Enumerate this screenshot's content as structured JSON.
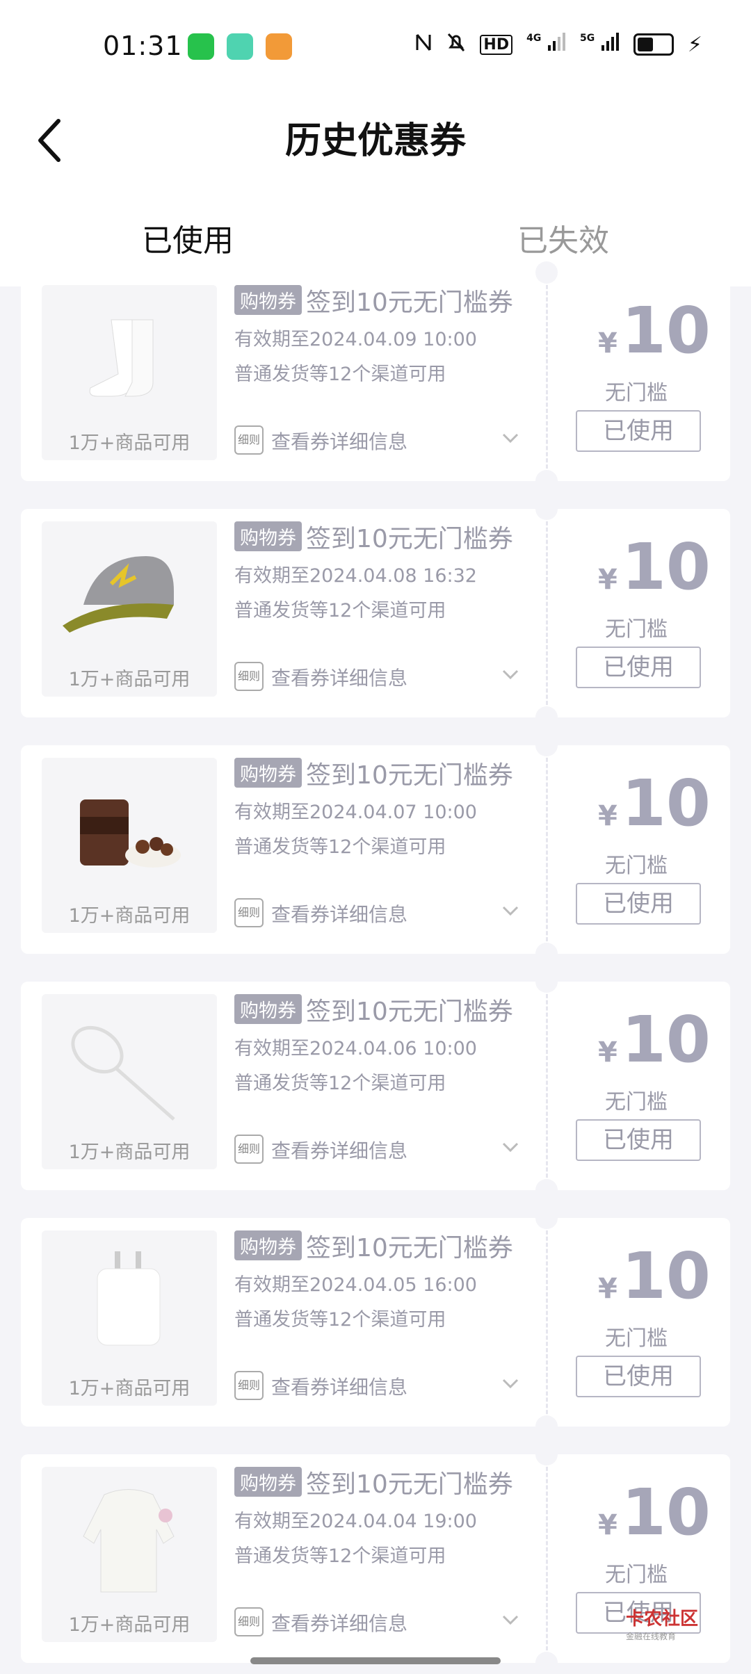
{
  "status_bar": {
    "time": "01:31",
    "hd_label": "HD",
    "net1": "4G",
    "net2": "5G"
  },
  "header": {
    "title": "历史优惠券"
  },
  "tabs": [
    {
      "label": "已使用",
      "active": true
    },
    {
      "label": "已失效",
      "active": false
    }
  ],
  "coupons": [
    {
      "tag": "购物券",
      "title": "签到10元无门槛券",
      "expiry": "有效期至2024.04.09 10:00",
      "channel": "普通发货等12个渠道可用",
      "thumb_caption": "1万+商品可用",
      "details": "查看券详细信息",
      "currency": "¥",
      "amount": "10",
      "threshold": "无门槛",
      "status": "已使用",
      "product_icon": "socks"
    },
    {
      "tag": "购物券",
      "title": "签到10元无门槛券",
      "expiry": "有效期至2024.04.08 16:32",
      "channel": "普通发货等12个渠道可用",
      "thumb_caption": "1万+商品可用",
      "details": "查看券详细信息",
      "currency": "¥",
      "amount": "10",
      "threshold": "无门槛",
      "status": "已使用",
      "product_icon": "cap"
    },
    {
      "tag": "购物券",
      "title": "签到10元无门槛券",
      "expiry": "有效期至2024.04.07 10:00",
      "channel": "普通发货等12个渠道可用",
      "thumb_caption": "1万+商品可用",
      "details": "查看券详细信息",
      "currency": "¥",
      "amount": "10",
      "threshold": "无门槛",
      "status": "已使用",
      "product_icon": "snack-jar"
    },
    {
      "tag": "购物券",
      "title": "签到10元无门槛券",
      "expiry": "有效期至2024.04.06 10:00",
      "channel": "普通发货等12个渠道可用",
      "thumb_caption": "1万+商品可用",
      "details": "查看券详细信息",
      "currency": "¥",
      "amount": "10",
      "threshold": "无门槛",
      "status": "已使用",
      "product_icon": "badminton-racket"
    },
    {
      "tag": "购物券",
      "title": "签到10元无门槛券",
      "expiry": "有效期至2024.04.05 16:00",
      "channel": "普通发货等12个渠道可用",
      "thumb_caption": "1万+商品可用",
      "details": "查看券详细信息",
      "currency": "¥",
      "amount": "10",
      "threshold": "无门槛",
      "status": "已使用",
      "product_icon": "charger"
    },
    {
      "tag": "购物券",
      "title": "签到10元无门槛券",
      "expiry": "有效期至2024.04.04 19:00",
      "channel": "普通发货等12个渠道可用",
      "thumb_caption": "1万+商品可用",
      "details": "查看券详细信息",
      "currency": "¥",
      "amount": "10",
      "threshold": "无门槛",
      "status": "已使用",
      "product_icon": "jacket"
    }
  ],
  "watermark": {
    "main": "卡农社区",
    "sub": "金融在线教育"
  },
  "colors": {
    "tag_bg": "#a6a6b3",
    "price": "#a6a6b8",
    "page_bg": "#f4f4f8"
  }
}
